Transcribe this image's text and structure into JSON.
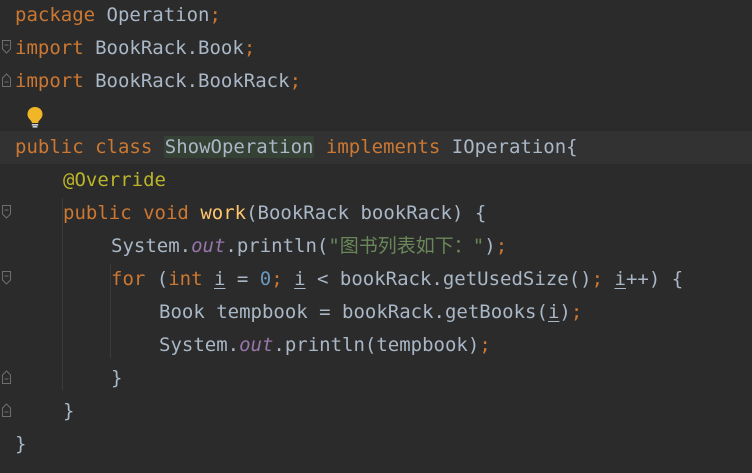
{
  "lines": [
    {
      "kind": "pkg",
      "kw": "package",
      "name": "Operation"
    },
    {
      "kind": "imp",
      "kw": "import",
      "name": "BookRack.Book"
    },
    {
      "kind": "imp",
      "kw": "import",
      "name": "BookRack.BookRack"
    },
    {
      "kind": "blank"
    },
    {
      "kind": "classdecl",
      "kw1": "public",
      "kw2": "class",
      "cls": "ShowOperation",
      "kw3": "implements",
      "iface": "IOperation{"
    },
    {
      "kind": "annotation",
      "text": "@Override"
    },
    {
      "kind": "methoddecl",
      "kw1": "public",
      "kw2": "void",
      "fn": "work",
      "params": "(BookRack bookRack) {"
    },
    {
      "kind": "println1",
      "sys": "System.",
      "out": "out",
      "call": ".println(",
      "str": "\"图书列表如下：\"",
      "end": ");"
    },
    {
      "kind": "forloop"
    },
    {
      "kind": "stmt1"
    },
    {
      "kind": "println2"
    },
    {
      "kind": "close",
      "text": "}"
    },
    {
      "kind": "close",
      "text": "}"
    },
    {
      "kind": "close",
      "text": "}"
    }
  ],
  "text": {
    "for_kw": "for",
    "for_open": " (",
    "int_kw": "int",
    "i": "i",
    "eq": " = ",
    "zero": "0",
    "semi": ";",
    "lt": " < bookRack.getUsedSize()",
    "pp": "++) {",
    "book_decl": "Book tempbook = bookRack.getBooks(",
    "book_end": ")",
    "sys2": "System.",
    "out2": "out",
    "call2": ".println(tempbook)",
    "brace": "}"
  },
  "icons": {
    "bulb": "lightbulb-icon",
    "fold": "fold-marker-icon"
  }
}
